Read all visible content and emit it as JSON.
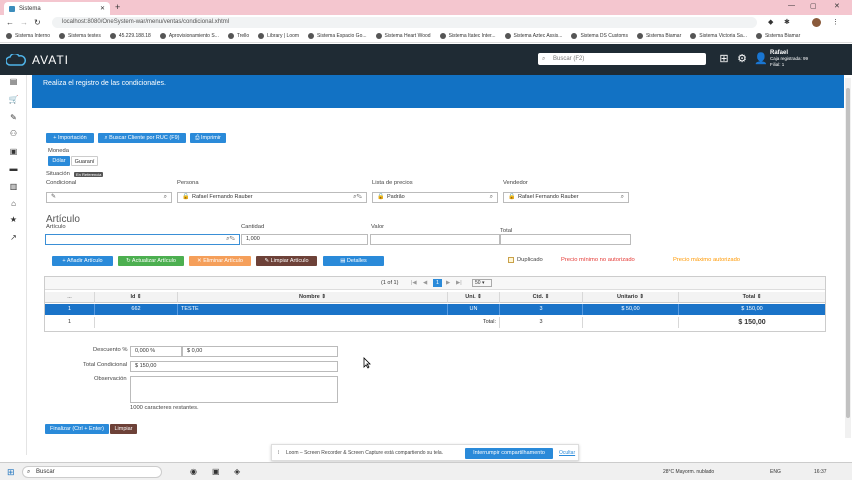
{
  "browser": {
    "tab_title": "Sistema",
    "url": "localhost:8080/OneSystem-war/menu/ventas/condicional.xhtml",
    "bookmarks": [
      "Sistema Interno",
      "Sistema testes",
      "45.229.188.18",
      "Aprovisionamiento S...",
      "Trello",
      "Library | Loom",
      "Sistema Espacio Go...",
      "Sistema Heart Wood",
      "Sistema Itatec Inter...",
      "Sistema Aztec Assis...",
      "Sistema DS Customs",
      "Sistema Biamar",
      "Sistema Victoria Sa...",
      "Sistema Biamar"
    ]
  },
  "header": {
    "logo": "AVATI",
    "search_placeholder": "Buscar (F2)",
    "user_name": "Rafael",
    "user_line2": "Caja registrada: 99",
    "user_line3": "Filial: 1"
  },
  "banner": {
    "text": "Realiza el registro de las condicionales."
  },
  "toolbar": {
    "importacion": "Importación",
    "buscar_cliente": "Buscar Cliente por RUC (F9)",
    "imprimir": "Imprimir"
  },
  "form": {
    "moneda_label": "Moneda",
    "moneda_options": [
      "Dólar",
      "Guaraní"
    ],
    "situacion_label": "Situación",
    "situacion_badge": "En Referencia",
    "condicional_label": "Condicional",
    "persona_label": "Persona",
    "persona_value": "Rafael Fernando Rauber",
    "lista_label": "Lista de precios",
    "lista_value": "Padrão",
    "vendedor_label": "Vendedor",
    "vendedor_value": "Rafael Fernando Rauber"
  },
  "articulo": {
    "section_title": "Artículo",
    "articulo_label": "Artículo",
    "cantidad_label": "Cantidad",
    "cantidad_value": "1,000",
    "valor_label": "Valor",
    "total_label": "Total"
  },
  "actions": {
    "add": "Añadir Artículo",
    "update": "Actualizar Artículo",
    "delete": "Eliminar Artículo",
    "clear": "Limpiar Artículo",
    "details": "Detalles",
    "duplicado": "Duplicado",
    "warning_min": "Precio mínimo no autorizado",
    "warning_max": "Precio máximo autorizado"
  },
  "pagination": {
    "info": "(1 of 1)",
    "page": "1",
    "per_page": "50"
  },
  "table": {
    "columns": [
      "...",
      "Id",
      "Nombre",
      "Uni.",
      "Ctd.",
      "Unitario",
      "Total"
    ],
    "rows": [
      {
        "n": "1",
        "id": "662",
        "nombre": "TESTE",
        "uni": "UN",
        "ctd": "3",
        "unitario": "$ 50,00",
        "total": "$ 150,00"
      }
    ],
    "footer": {
      "n": "1",
      "label": "Total:",
      "ctd": "3",
      "total": "$ 150,00"
    }
  },
  "summary": {
    "descuento_label": "Descuento %",
    "descuento_pct": "0,000 %",
    "descuento_amt": "$ 0,00",
    "total_label": "Total Condicional",
    "total_value": "$ 150,00",
    "obs_label": "Observación",
    "remaining": "1000 caracteres restantes."
  },
  "footer_buttons": {
    "finalizar": "Finalizar (Ctrl + Enter)",
    "limpiar": "Limpiar"
  },
  "loom": {
    "message": "Loom – Screen Recorder & Screen Capture está compartiendo su tela.",
    "stop": "Interrumpir compartilhamento",
    "hide": "Ocultar"
  },
  "taskbar": {
    "search": "Buscar",
    "weather": "28°C  Mayorm. nublado",
    "lang": "ENG",
    "time": "16:37"
  },
  "colors": {
    "primary": "#2a8ad9",
    "header": "#1f2b34",
    "selected_row": "#1a73c8",
    "danger_text": "#e53935",
    "warn_text": "#ff9800"
  }
}
